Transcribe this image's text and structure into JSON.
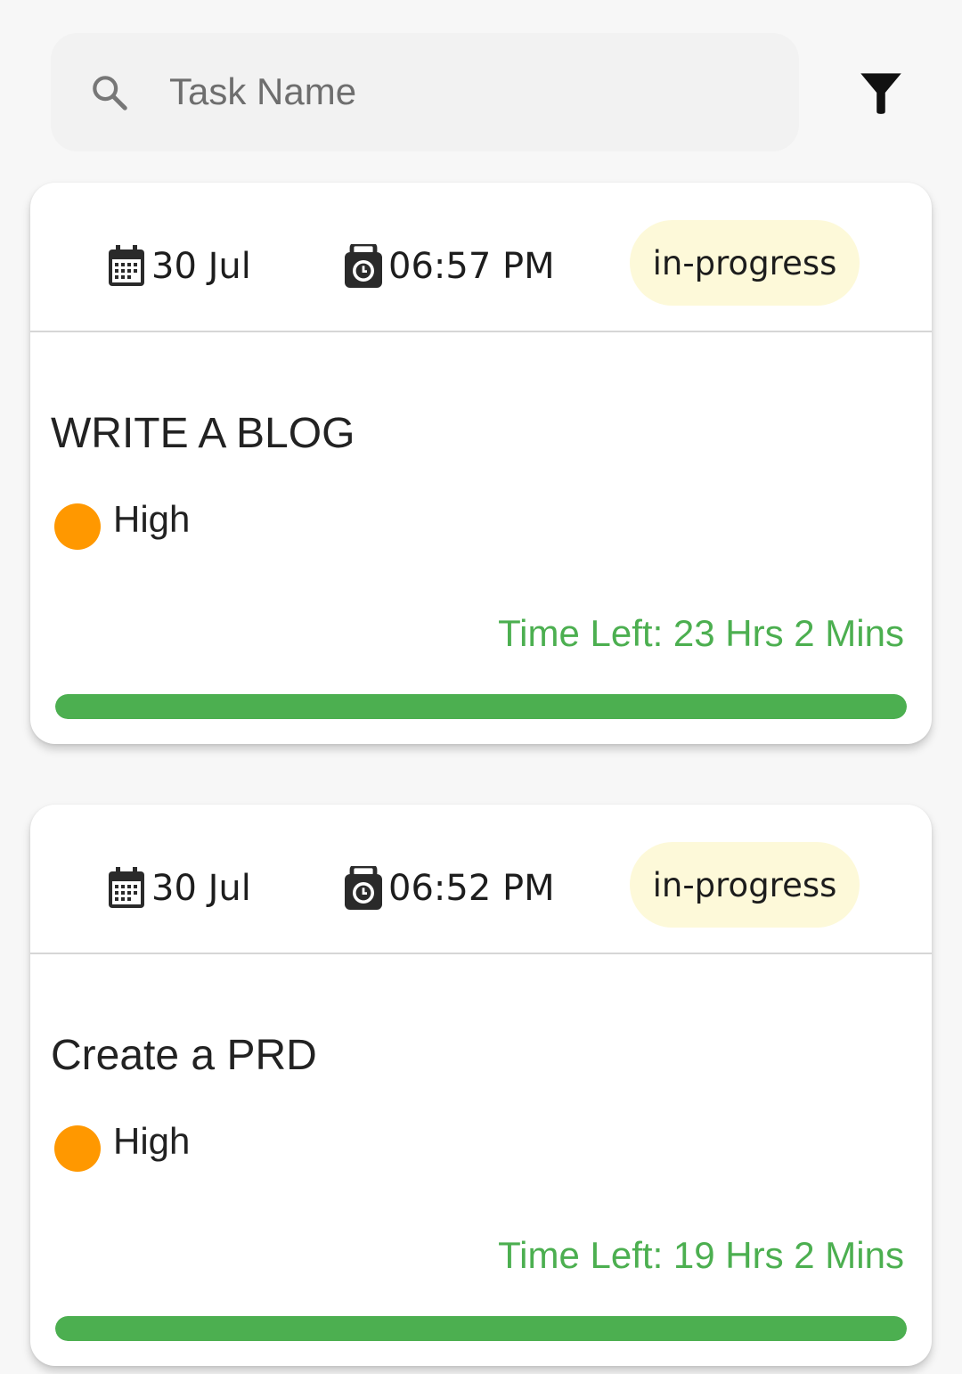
{
  "search": {
    "placeholder": "Task Name",
    "value": "",
    "icon": "search-icon"
  },
  "toolbar": {
    "filter_icon": "filter-icon"
  },
  "colors": {
    "accent_green": "#4caf50",
    "priority_high": "#ff9800",
    "status_badge_bg": "#fdf9d9"
  },
  "tasks": [
    {
      "date": "30 Jul",
      "time": "06:57 PM",
      "status": "in-progress",
      "title": "WRITE A BLOG",
      "priority": "High",
      "time_left": "Time Left: 23 Hrs 2 Mins",
      "progress": 1.0
    },
    {
      "date": "30 Jul",
      "time": "06:52 PM",
      "status": "in-progress",
      "title": "Create a PRD",
      "priority": "High",
      "time_left": "Time Left: 19 Hrs 2 Mins",
      "progress": 1.0
    }
  ]
}
